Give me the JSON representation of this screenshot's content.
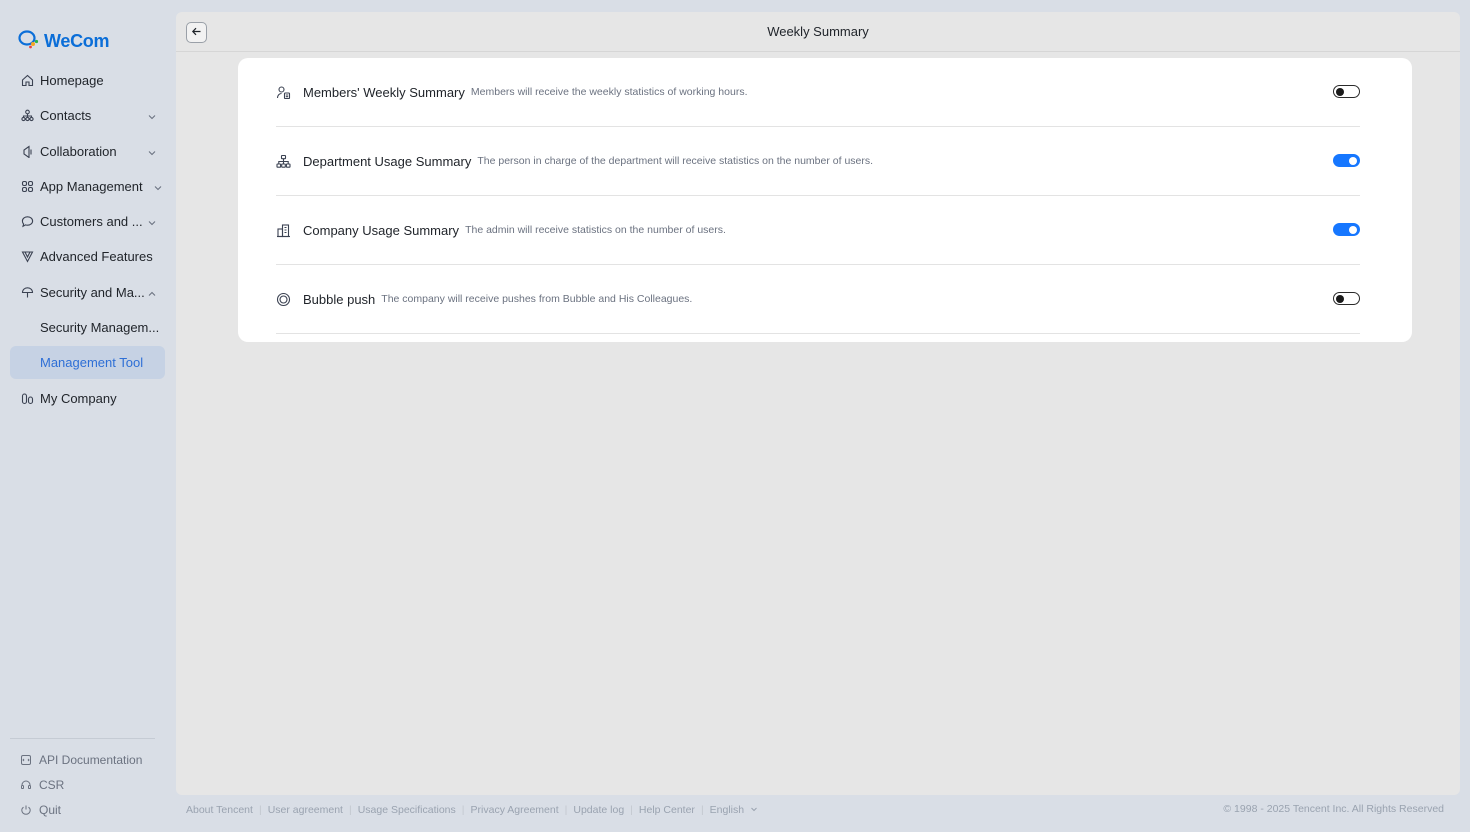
{
  "app": {
    "brand": "WeCom",
    "brand_color": "#0b6ed8",
    "accent_color": "#1677ff"
  },
  "sidebar": {
    "items": [
      {
        "label": "Homepage",
        "icon": "home-icon"
      },
      {
        "label": "Contacts",
        "icon": "org-chart-icon",
        "expandable": true
      },
      {
        "label": "Collaboration",
        "icon": "collaboration-icon",
        "expandable": true
      },
      {
        "label": "App Management",
        "icon": "apps-grid-icon",
        "expandable": true
      },
      {
        "label": "Customers and ...",
        "icon": "chat-bubble-icon",
        "expandable": true
      },
      {
        "label": "Advanced Features",
        "icon": "diamond-icon"
      },
      {
        "label": "Security and Ma...",
        "icon": "umbrella-icon",
        "expanded": true
      },
      {
        "label": "Security Managem...",
        "sub": true
      },
      {
        "label": "Management Tool",
        "sub": true,
        "active": true
      },
      {
        "label": "My Company",
        "icon": "company-icon"
      }
    ],
    "bottom": [
      {
        "label": "API Documentation",
        "icon": "api-doc-icon"
      },
      {
        "label": "CSR",
        "icon": "csr-icon"
      },
      {
        "label": "Quit",
        "icon": "power-icon"
      }
    ]
  },
  "header": {
    "title": "Weekly Summary",
    "back_icon": "arrow-left-icon"
  },
  "settings": [
    {
      "title": "Members' Weekly Summary",
      "desc": "Members will receive the weekly statistics of working hours.",
      "icon": "member-icon",
      "enabled": false
    },
    {
      "title": "Department Usage Summary",
      "desc": "The person in charge of the department will receive statistics on the number of users.",
      "icon": "department-icon",
      "enabled": true
    },
    {
      "title": "Company Usage Summary",
      "desc": "The admin will receive statistics on the number of users.",
      "icon": "building-icon",
      "enabled": true
    },
    {
      "title": "Bubble push",
      "desc": "The company will receive pushes from Bubble and His Colleagues.",
      "icon": "bubble-icon",
      "enabled": false
    }
  ],
  "footer": {
    "links": [
      "About Tencent",
      "User agreement",
      "Usage Specifications",
      "Privacy Agreement",
      "Update log",
      "Help Center",
      "English"
    ],
    "copyright": "© 1998 - 2025 Tencent Inc. All Rights Reserved"
  }
}
